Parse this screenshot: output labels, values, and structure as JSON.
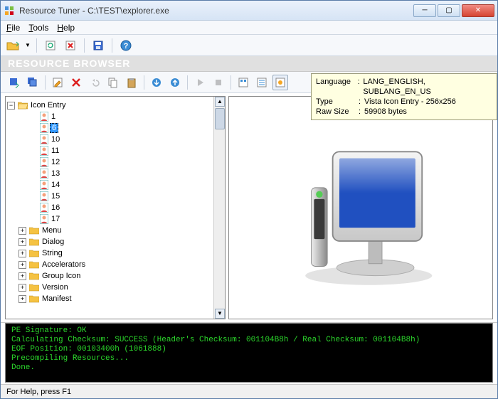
{
  "title": "Resource Tuner - C:\\TEST\\explorer.exe",
  "menu": {
    "file": "File",
    "tools": "Tools",
    "help": "Help"
  },
  "section_title": "RESOURCE BROWSER",
  "tooltip": {
    "lang_k": "Language",
    "lang_v": "LANG_ENGLISH, SUBLANG_EN_US",
    "type_k": "Type",
    "type_v": "Vista Icon Entry - 256x256",
    "size_k": "Raw Size",
    "size_v": "59908 bytes"
  },
  "tree": {
    "root": "Icon Entry",
    "icons": [
      "1",
      "6",
      "10",
      "11",
      "12",
      "13",
      "14",
      "15",
      "16",
      "17"
    ],
    "selected_index": 1,
    "folders": [
      "Menu",
      "Dialog",
      "String",
      "Accelerators",
      "Group Icon",
      "Version",
      "Manifest"
    ]
  },
  "console": {
    "l1": "PE Signature: OK",
    "l2": "Calculating Checksum: SUCCESS (Header's Checksum: 001104B8h / Real Checksum: 001104B8h)",
    "l3": "EOF Position: 00103400h  (1061888)",
    "l4": "Precompiling Resources...",
    "l5": "Done."
  },
  "status": "For Help, press F1"
}
